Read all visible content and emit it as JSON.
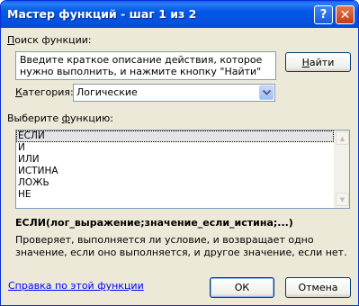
{
  "window": {
    "title": "Мастер функций - шаг 1 из 2",
    "help_btn": "?",
    "close_btn": "✕"
  },
  "search": {
    "label_underlined": "П",
    "label_rest": "оиск функции:",
    "description": "Введите краткое описание действия, которое нужно выполнить, и нажмите кнопку \"Найти\"",
    "find_underlined": "Н",
    "find_rest": "айти"
  },
  "category": {
    "label_underlined": "К",
    "label_rest": "атегория:",
    "value": "Логические"
  },
  "function_list": {
    "label_pre": "Выберите ",
    "label_underlined": "ф",
    "label_post": "ункцию:",
    "items": [
      "ЕСЛИ",
      "И",
      "ИЛИ",
      "ИСТИНА",
      "ЛОЖЬ",
      "НЕ"
    ],
    "selected_index": 0
  },
  "details": {
    "signature": "ЕСЛИ(лог_выражение;значение_если_истина;...)",
    "description": "Проверяет, выполняется ли условие, и возвращает одно значение, если оно выполняется, и другое значение, если нет."
  },
  "footer": {
    "help_link": "Справка по этой функции",
    "ok": "ОК",
    "cancel": "Отмена"
  },
  "colors": {
    "titlebar": "#0058e6",
    "dialog_bg": "#ece9d8",
    "link": "#0000ff",
    "selection": "#e4e4e4"
  }
}
